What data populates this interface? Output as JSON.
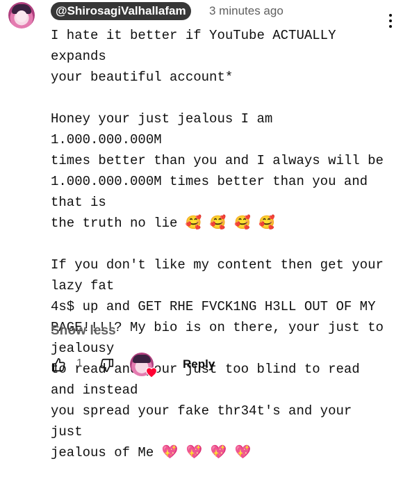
{
  "comment": {
    "author": "@ShirosagiValhallafam",
    "timestamp": "3 minutes ago",
    "text": "I hate it better if YouTube ACTUALLY expands\nyour beautiful account*\n\nHoney your just jealous I am 1.000.000.000M\ntimes better than you and I always will be\n1.000.000.000M times better than you and that is\nthe truth no lie 🥰 🥰 🥰 🥰\n\nIf you don't like my content then get your lazy fat\n4s$ up and GET RHE FVCK1NG H3LL OUT OF MY\nPAGE!!!!? My bio is on there, your just to jealousy\nto read and your just too blind to read and instead\nyou spread your fake thr34t's and your just\njealous of Me 💖 💖 💖 💖",
    "show_less_label": "Show less",
    "like_count": "1",
    "reply_label": "Reply"
  },
  "icons": {
    "avatar": "avatar-icon",
    "menu": "more-vert-icon",
    "like": "thumb-up-icon",
    "dislike": "thumb-down-icon",
    "creator_heart": "creator-heart-icon"
  },
  "colors": {
    "author_chip_bg": "#373737",
    "secondary_text": "#606060",
    "heart": "#ff0033"
  }
}
